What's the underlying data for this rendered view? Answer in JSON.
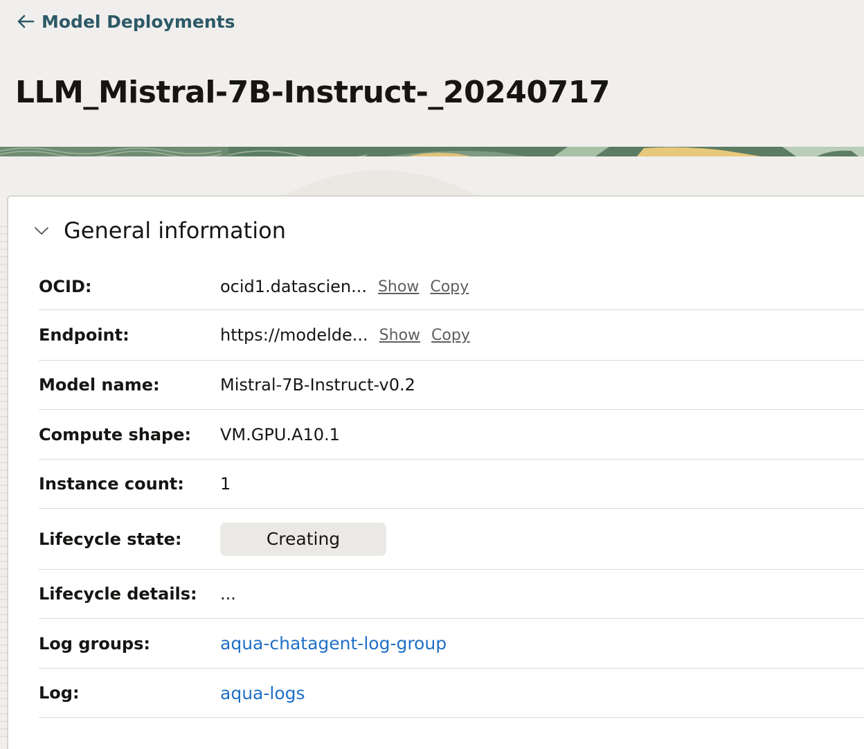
{
  "back_link": {
    "label": "Model Deployments",
    "icon": "arrow-left-icon"
  },
  "page_title": "LLM_Mistral-7B-Instruct-_20240717",
  "section": {
    "title": "General information",
    "icon": "chevron-down-icon"
  },
  "rows": [
    {
      "label": "OCID:",
      "value": "ocid1.datascien...",
      "show": "Show",
      "copy": "Copy"
    },
    {
      "label": "Endpoint:",
      "value": "https://modelde...",
      "show": "Show",
      "copy": "Copy"
    },
    {
      "label": "Model name:",
      "value": "Mistral-7B-Instruct-v0.2"
    },
    {
      "label": "Compute shape:",
      "value": "VM.GPU.A10.1"
    },
    {
      "label": "Instance count:",
      "value": "1"
    },
    {
      "label": "Lifecycle state:",
      "value": "Creating"
    },
    {
      "label": "Lifecycle details:",
      "value": "..."
    },
    {
      "label": "Log groups:",
      "value": "aqua-chatagent-log-group"
    },
    {
      "label": "Log:",
      "value": "aqua-logs"
    }
  ],
  "colors": {
    "link_dark": "#2c5967",
    "link_blue": "#1f6fc6",
    "background": "#f1efed",
    "badge_bg": "#ebe9e6"
  }
}
